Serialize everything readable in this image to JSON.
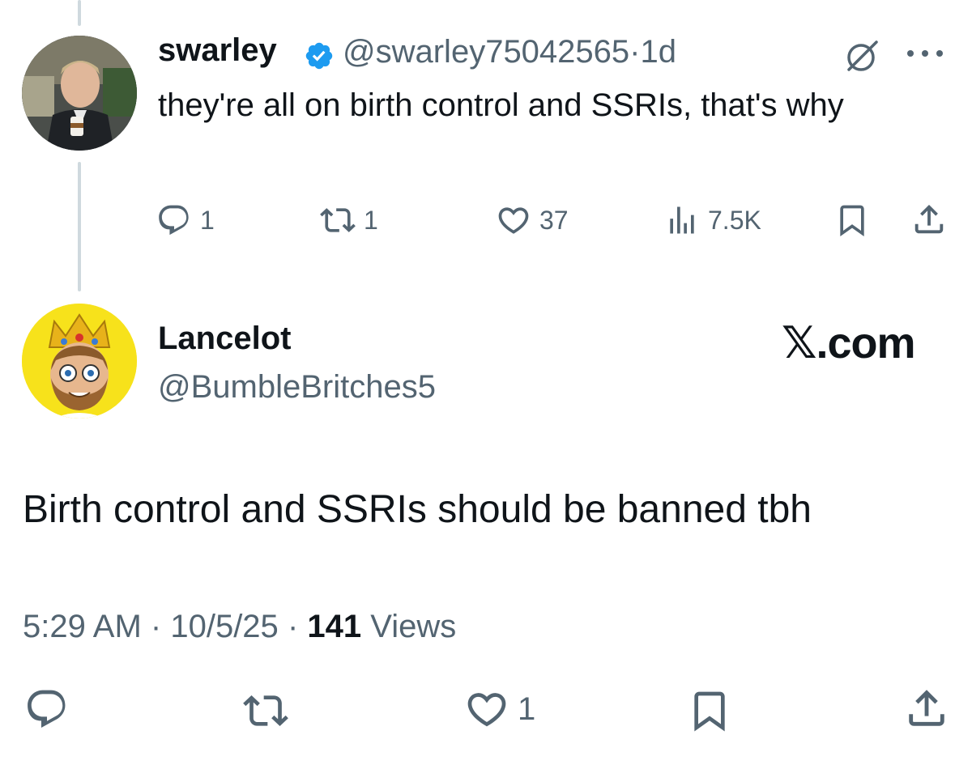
{
  "parent_tweet": {
    "display_name": "swarley",
    "handle": "@swarley75042565",
    "separator": "·",
    "time_ago": "1d",
    "text": "they're all on birth control and SSRIs, that's why",
    "stats": {
      "replies": "1",
      "retweets": "1",
      "likes": "37",
      "views": "7.5K"
    }
  },
  "main_tweet": {
    "display_name": "Lancelot",
    "handle": "@BumbleBritches5",
    "brand": "𝕏.com",
    "text": "Birth control and SSRIs should be banned tbh",
    "time": "5:29 AM",
    "separator": "·",
    "date": "10/5/25",
    "views_count": "141",
    "views_label": "Views",
    "likes": "1"
  },
  "colors": {
    "text_primary": "#0f1419",
    "text_secondary": "#536471",
    "verified_blue": "#1d9bf0",
    "thread_line": "#cfd9de"
  },
  "icons": [
    "reply-icon",
    "retweet-icon",
    "like-icon",
    "views-icon",
    "bookmark-icon",
    "share-icon",
    "verified-badge-icon",
    "grok-icon",
    "more-icon"
  ]
}
